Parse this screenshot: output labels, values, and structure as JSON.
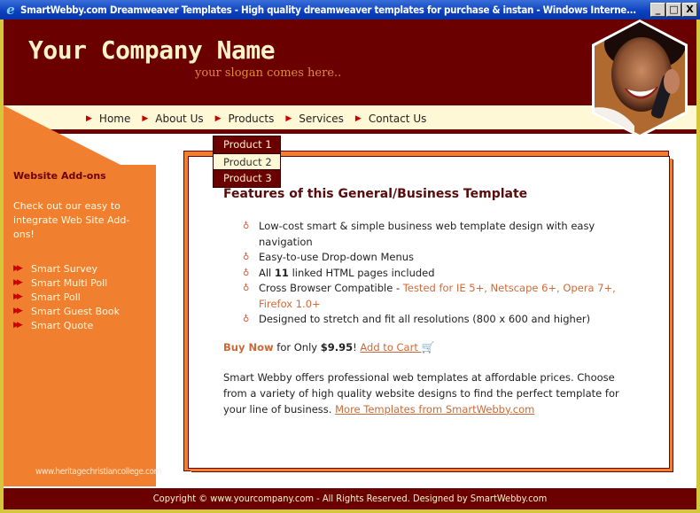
{
  "window": {
    "title": "SmartWebby.com Dreamweaver Templates - High quality dreamweaver templates for purchase & instan - Windows Interne...",
    "minimize": "_",
    "maximize": "□",
    "close": "X"
  },
  "header": {
    "company_name": "Your Company Name",
    "slogan": "your slogan comes here.."
  },
  "nav": {
    "items": [
      {
        "label": "Home"
      },
      {
        "label": "About Us"
      },
      {
        "label": "Products"
      },
      {
        "label": "Services"
      },
      {
        "label": "Contact Us"
      }
    ],
    "dropdown": [
      {
        "label": "Product 1"
      },
      {
        "label": "Product 2"
      },
      {
        "label": "Product 3"
      }
    ]
  },
  "sidebar": {
    "title": "Website Add-ons",
    "text": "Check out our easy to integrate Web Site Add-ons!",
    "items": [
      {
        "label": "Smart Survey"
      },
      {
        "label": "Smart Multi Poll"
      },
      {
        "label": "Smart Poll"
      },
      {
        "label": "Smart Guest Book"
      },
      {
        "label": "Smart Quote"
      }
    ],
    "watermark": "www.heritagechristiancollege.com"
  },
  "content": {
    "heading": "Features of this General/Business Template",
    "features": {
      "f1": "Low-cost smart & simple business web template design with easy navigation",
      "f2": "Easy-to-use Drop-down Menus",
      "f3_pre": "All ",
      "f3_bold": "11",
      "f3_post": " linked HTML pages included",
      "f4_pre": "Cross Browser Compatible - ",
      "f4_orange": "Tested for IE 5+, Netscape 6+, Opera 7+, Firefox 1.0+",
      "f5": "Designed to stretch and fit all resolutions (800 x 600 and higher)"
    },
    "buy": {
      "buy_now": "Buy Now",
      "for_only": " for Only ",
      "price": "$9.95",
      "excl": "! ",
      "add_to_cart": "Add to Cart "
    },
    "para_text": "Smart Webby offers professional web templates at affordable prices. Choose from a variety of high quality website designs to find the perfect template for your line of business. ",
    "para_link": "More Templates from SmartWebby.com"
  },
  "footer": {
    "text": "Copyright © www.yourcompany.com - All Rights Reserved. Designed by SmartWebby.com"
  },
  "colors": {
    "maroon": "#6b0000",
    "orange": "#f08030",
    "cream": "#fef8d6",
    "link": "#c86a38"
  }
}
